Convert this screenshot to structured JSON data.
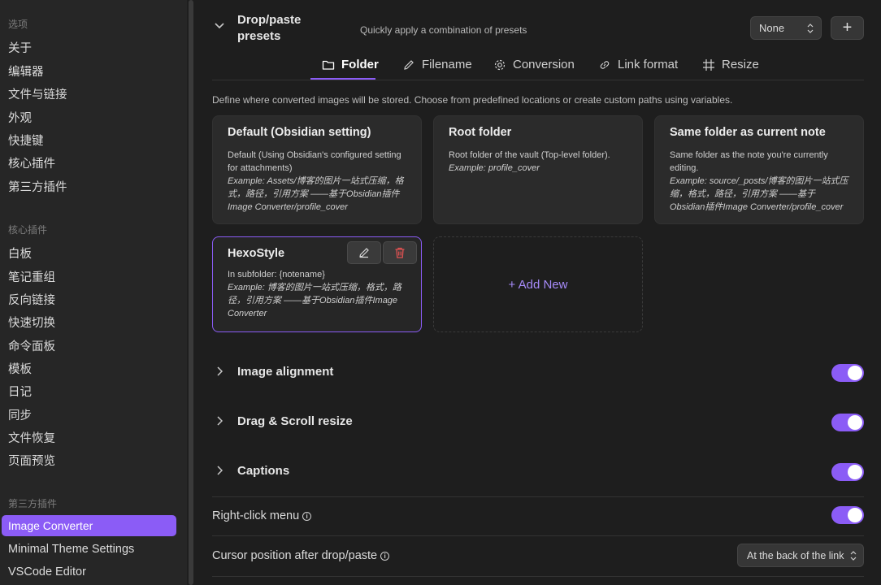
{
  "sidebar": {
    "section_options": "选项",
    "options": [
      "关于",
      "编辑器",
      "文件与链接",
      "外观",
      "快捷键",
      "核心插件",
      "第三方插件"
    ],
    "section_core": "核心插件",
    "core": [
      "白板",
      "笔记重组",
      "反向链接",
      "快速切换",
      "命令面板",
      "模板",
      "日记",
      "同步",
      "文件恢复",
      "页面预览"
    ],
    "section_third": "第三方插件",
    "third": [
      "Image Converter",
      "Minimal Theme Settings",
      "VSCode Editor"
    ]
  },
  "presets": {
    "title_line1": "Drop/paste",
    "title_line2": "presets",
    "description": "Quickly apply a combination of presets",
    "select_value": "None",
    "add_label": "+"
  },
  "tabs": [
    {
      "label": "Folder",
      "icon": "folder-icon"
    },
    {
      "label": "Filename",
      "icon": "pencil-icon"
    },
    {
      "label": "Conversion",
      "icon": "gear-icon"
    },
    {
      "label": "Link format",
      "icon": "link-icon"
    },
    {
      "label": "Resize",
      "icon": "resize-icon"
    }
  ],
  "folder_description": "Define where converted images will be stored. Choose from predefined locations or create custom paths using variables.",
  "cards": [
    {
      "title": "Default (Obsidian setting)",
      "text": "Default (Using Obsidian's configured setting for attachments)",
      "example": "Example: Assets/博客的图片一站式压缩，格式，路径，引用方案 ——基于Obsidian插件Image Converter/profile_cover"
    },
    {
      "title": "Root folder",
      "text": "Root folder of the vault (Top-level folder).",
      "example": "Example: profile_cover"
    },
    {
      "title": "Same folder as current note",
      "text": "Same folder as the note you're currently editing.",
      "example": "Example: source/_posts/博客的图片一站式压缩，格式，路径，引用方案 ——基于Obsidian插件Image Converter/profile_cover"
    },
    {
      "title": "HexoStyle",
      "text": "In subfolder: {notename}",
      "example": "Example: 博客的图片一站式压缩，格式，路径，引用方案 ——基于Obsidian插件Image Converter"
    }
  ],
  "add_new_label": "+ Add New",
  "sections": [
    {
      "label": "Image alignment",
      "enabled": true
    },
    {
      "label": "Drag & Scroll resize",
      "enabled": true
    },
    {
      "label": "Captions",
      "enabled": true
    }
  ],
  "right_click": {
    "label": "Right-click menu",
    "enabled": true
  },
  "cursor_position": {
    "label": "Cursor position after drop/paste",
    "value": "At the back of the link"
  },
  "colors": {
    "accent": "#8b5cf6",
    "delete": "#e05252"
  }
}
